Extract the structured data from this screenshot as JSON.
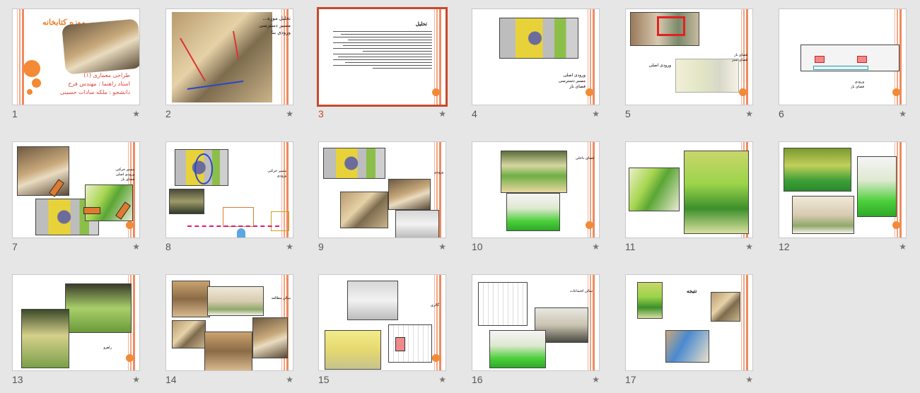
{
  "view": "slide-sorter",
  "accent_color": "#c8492c",
  "star_symbol": "★",
  "slides": [
    {
      "number": "1",
      "selected": false,
      "title": "موزه کتابخانه",
      "subtitle": [
        "طراحی معماری (۱)",
        "استاد راهنما : مهندس فرخ",
        "دانشجو : ملکه سادات حسینی"
      ]
    },
    {
      "number": "2",
      "selected": false,
      "text": [
        "تحلیل موزه...",
        "مسیر دسترسی",
        "ورودی بنا"
      ]
    },
    {
      "number": "3",
      "selected": true,
      "heading": "تحلیل"
    },
    {
      "number": "4",
      "selected": false,
      "labels": [
        "ورودی اصلی",
        "مسیر دسترسی",
        "فضای باز"
      ]
    },
    {
      "number": "5",
      "selected": false,
      "labels": [
        "ورودی اصلی",
        "فضای باز",
        "فضای سبز"
      ]
    },
    {
      "number": "6",
      "selected": false,
      "labels": [
        "ورودی",
        "فضای باز"
      ]
    },
    {
      "number": "7",
      "selected": false,
      "labels": [
        "مسیر حرکتی",
        "ورودی اصلی",
        "فضای باز"
      ]
    },
    {
      "number": "8",
      "selected": false,
      "labels": [
        "مسیر حرکتی",
        "ورودی"
      ]
    },
    {
      "number": "9",
      "selected": false,
      "labels": [
        "ورودی"
      ]
    },
    {
      "number": "10",
      "selected": false,
      "labels": [
        "فضای داخلی"
      ]
    },
    {
      "number": "11",
      "selected": false,
      "labels": []
    },
    {
      "number": "12",
      "selected": false,
      "labels": []
    },
    {
      "number": "13",
      "selected": false,
      "labels": [
        "راهرو"
      ]
    },
    {
      "number": "14",
      "selected": false,
      "labels": [
        "سالن مطالعه"
      ]
    },
    {
      "number": "15",
      "selected": false,
      "labels": [
        "گالری"
      ]
    },
    {
      "number": "16",
      "selected": false,
      "labels": [
        "سالن اجتماعات"
      ]
    },
    {
      "number": "17",
      "selected": false,
      "labels": [
        "نتیجه"
      ]
    }
  ]
}
